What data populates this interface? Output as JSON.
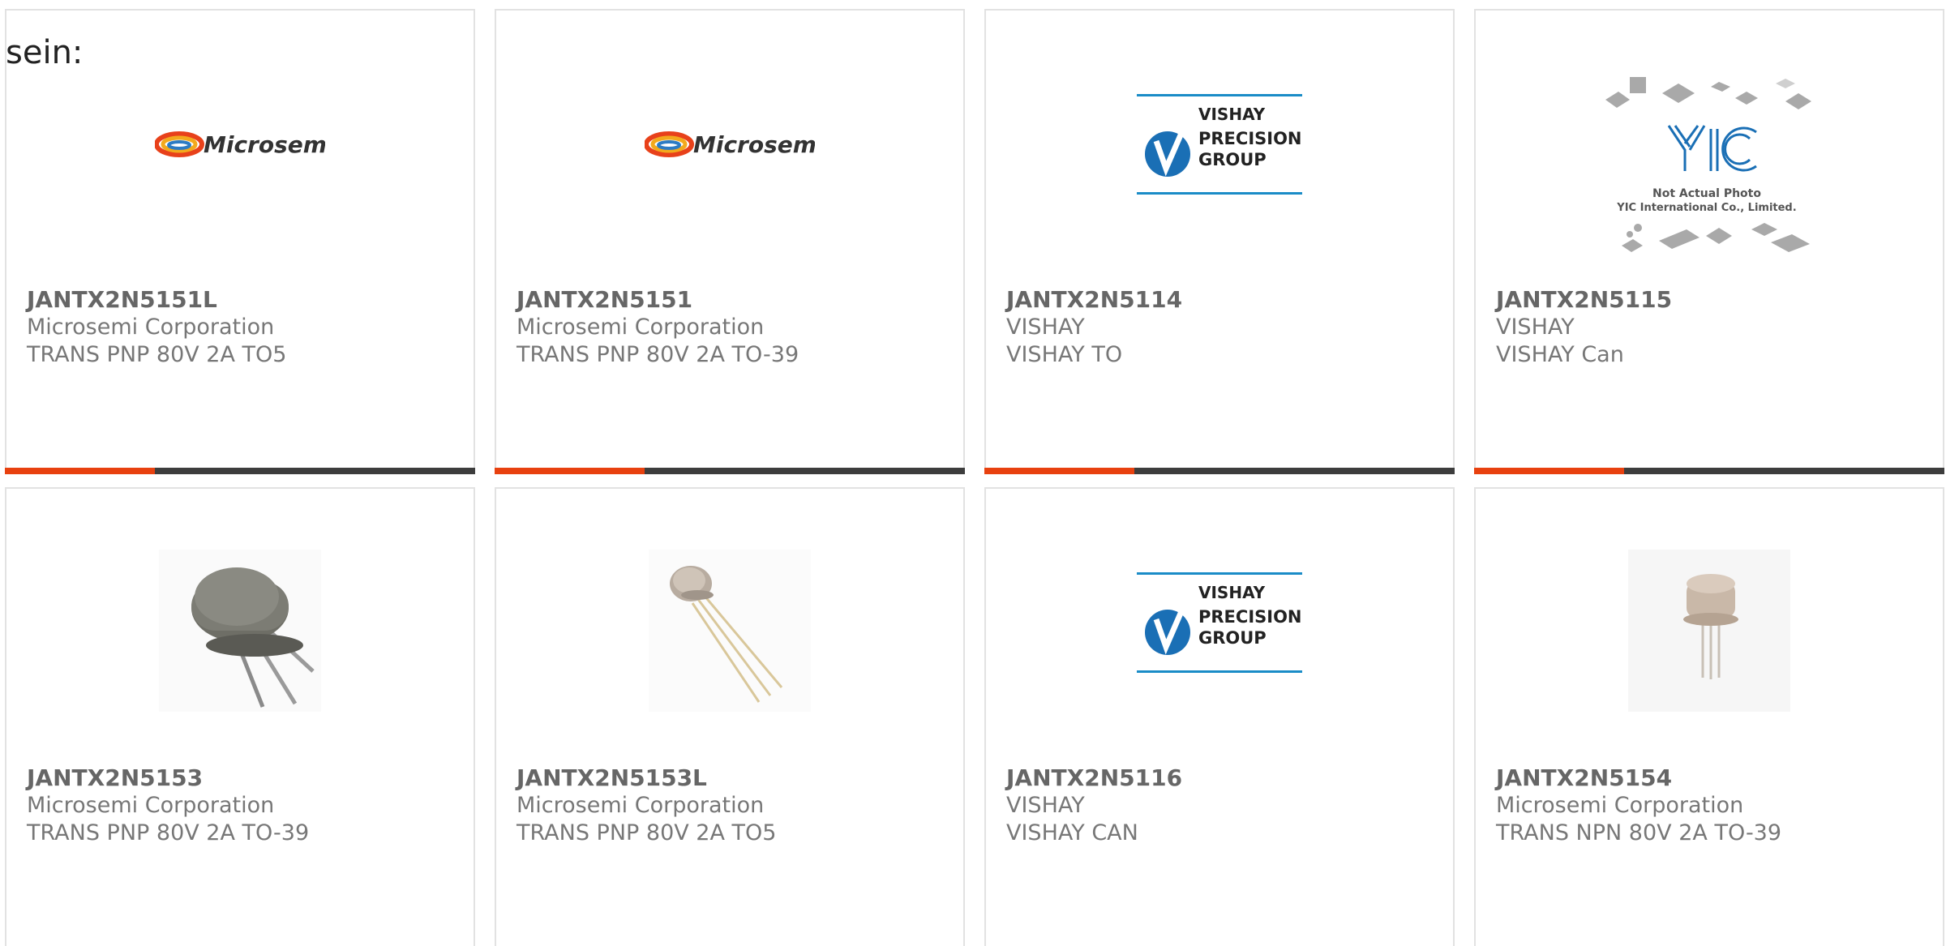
{
  "intro_text": "sein:",
  "colors": {
    "accent_bar": "#e8410f",
    "dark_bar": "#3d3d3d",
    "card_border": "#e2e2e2"
  },
  "products": [
    {
      "part": "JANTX2N5151L",
      "manufacturer": "Microsemi Corporation",
      "description": "TRANS PNP 80V 2A TO5",
      "image": "microsemi-logo",
      "logo_text": "Microsemi"
    },
    {
      "part": "JANTX2N5151",
      "manufacturer": "Microsemi Corporation",
      "description": "TRANS PNP 80V 2A TO-39",
      "image": "microsemi-logo",
      "logo_text": "Microsemi"
    },
    {
      "part": "JANTX2N5114",
      "manufacturer": "VISHAY",
      "description": "VISHAY TO",
      "image": "vishay-logo",
      "logo_lines": [
        "VISHAY",
        "PRECISION",
        "GROUP"
      ]
    },
    {
      "part": "JANTX2N5115",
      "manufacturer": "VISHAY",
      "description": "VISHAY Can",
      "image": "not-actual-photo",
      "placeholder_logo": "YIC",
      "placeholder_lines": [
        "Not Actual Photo",
        "YIC International Co., Limited."
      ]
    },
    {
      "part": "JANTX2N5153",
      "manufacturer": "Microsemi Corporation",
      "description": "TRANS PNP 80V 2A TO-39",
      "image": "to39-transistor-photo"
    },
    {
      "part": "JANTX2N5153L",
      "manufacturer": "Microsemi Corporation",
      "description": "TRANS PNP 80V 2A TO5",
      "image": "to5-transistor-photo"
    },
    {
      "part": "JANTX2N5116",
      "manufacturer": "VISHAY",
      "description": "VISHAY CAN",
      "image": "vishay-logo",
      "logo_lines": [
        "VISHAY",
        "PRECISION",
        "GROUP"
      ]
    },
    {
      "part": "JANTX2N5154",
      "manufacturer": "Microsemi Corporation",
      "description": "TRANS NPN 80V 2A TO-39",
      "image": "to39-transistor-photo-small"
    }
  ]
}
